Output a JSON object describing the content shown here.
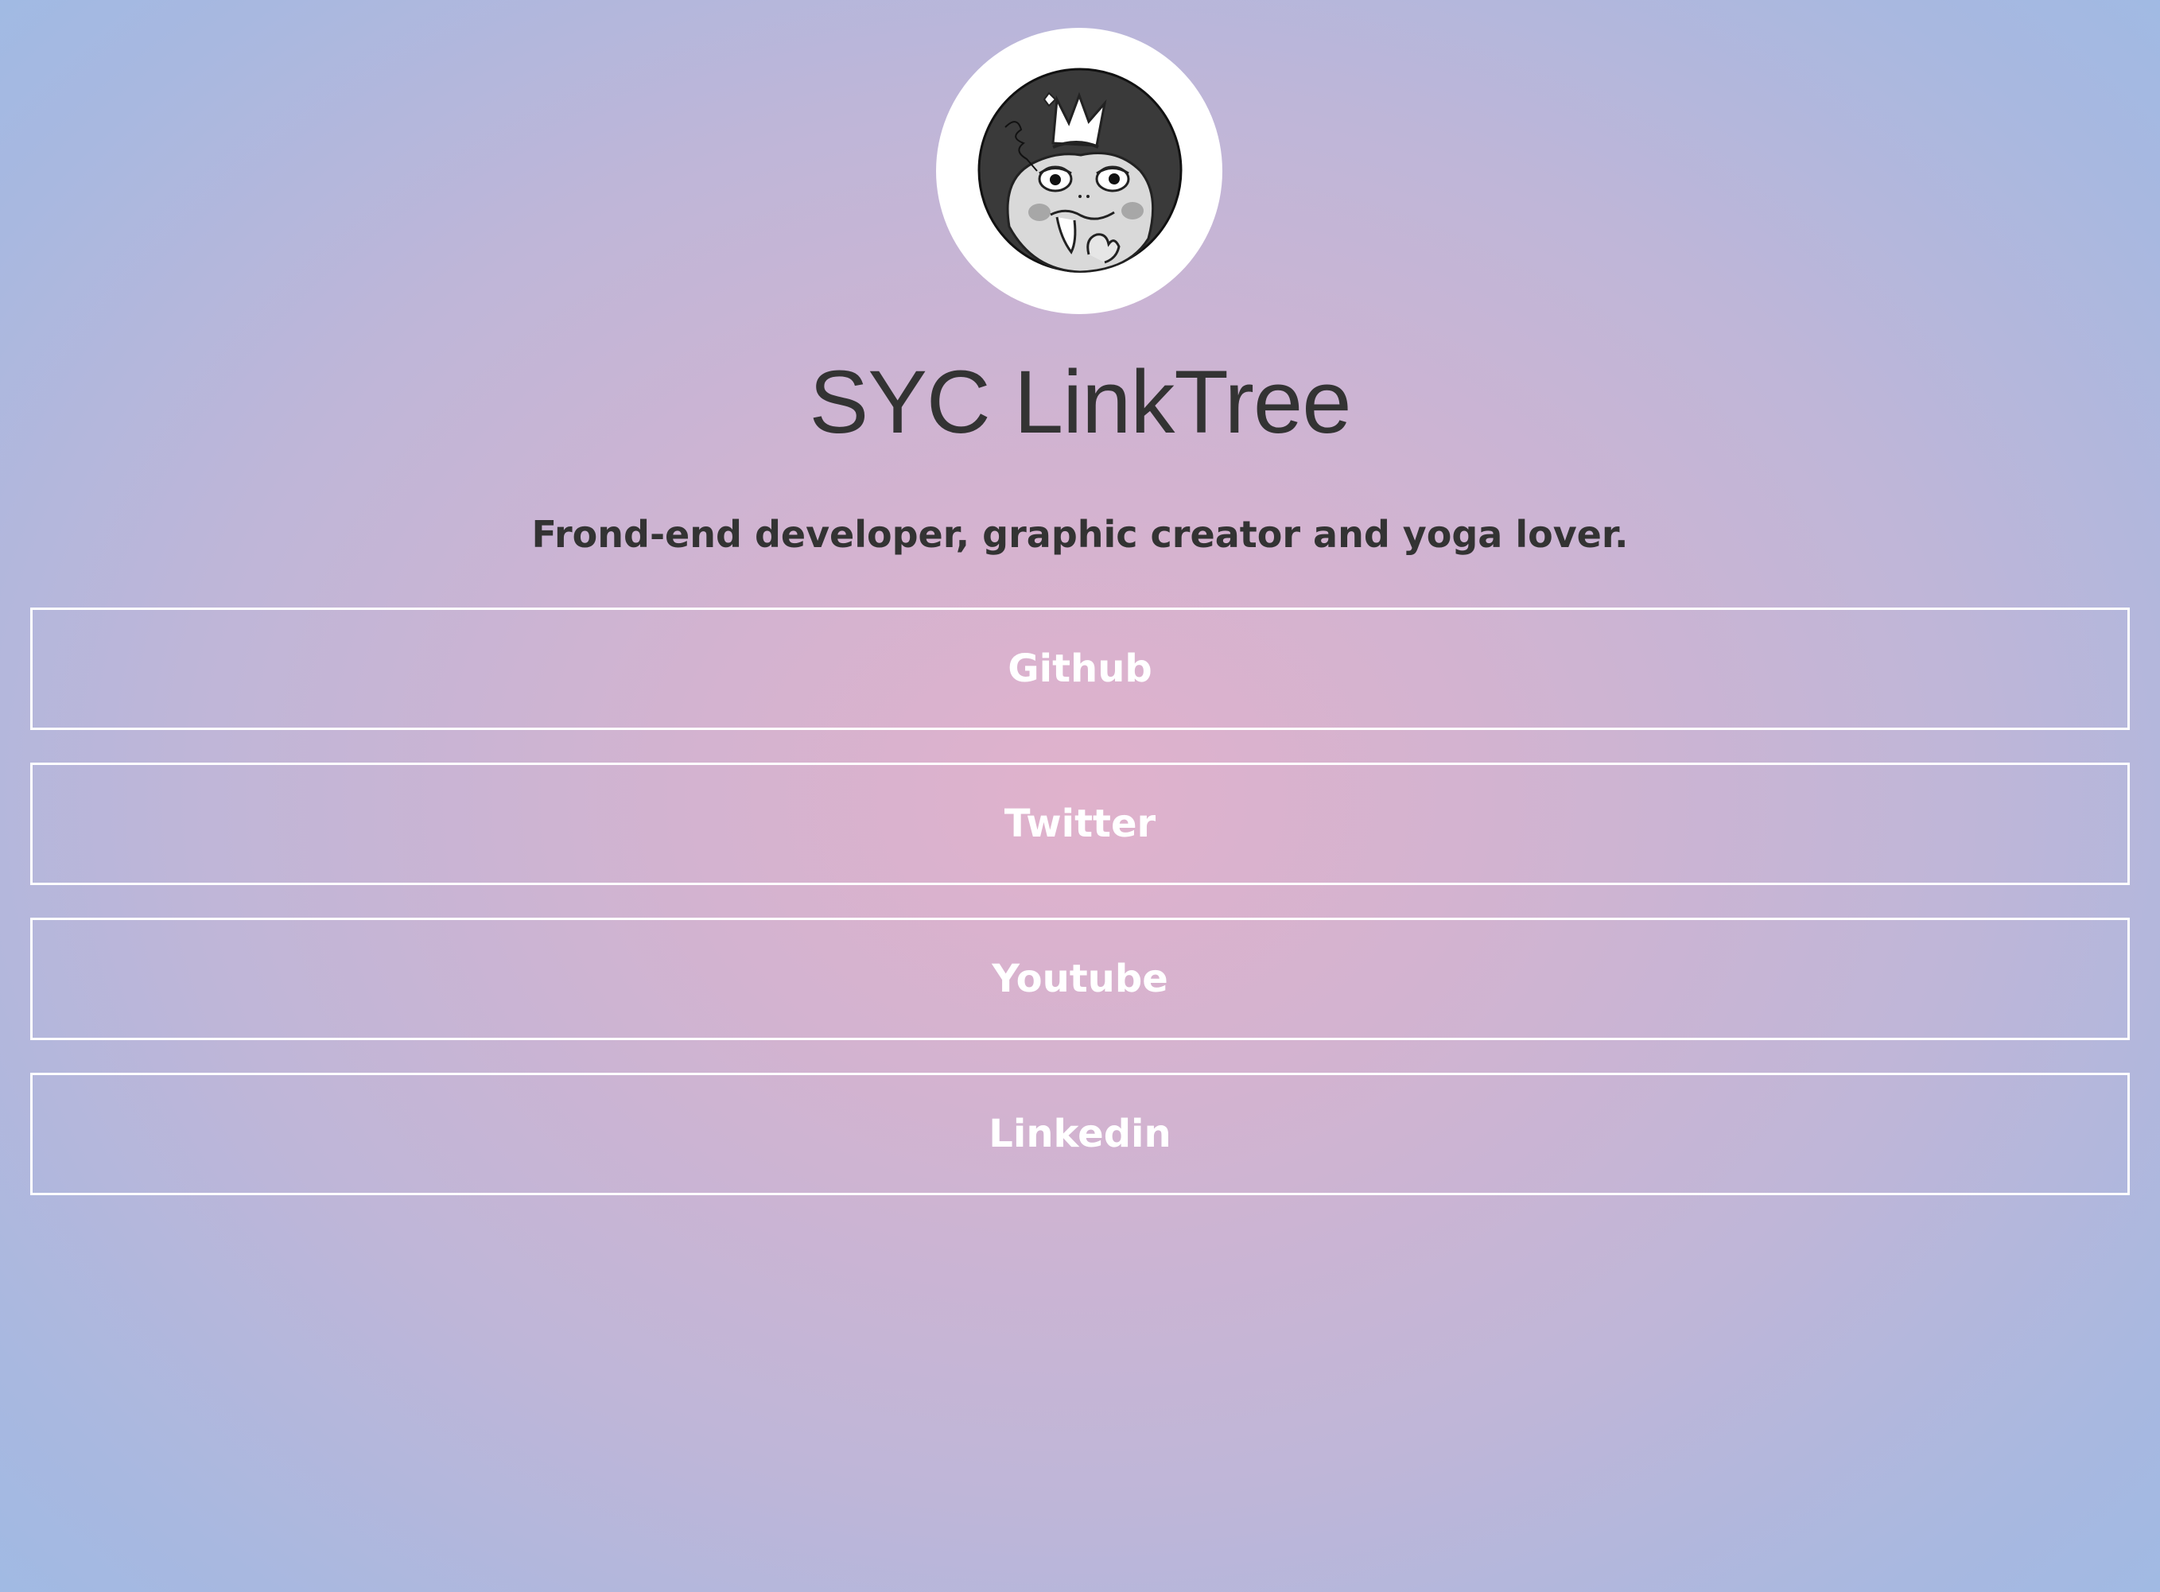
{
  "profile": {
    "title": "SYC LinkTree",
    "tagline": "Frond-end developer, graphic creator and yoga lover."
  },
  "links": [
    {
      "label": "Github"
    },
    {
      "label": "Twitter"
    },
    {
      "label": "Youtube"
    },
    {
      "label": "Linkedin"
    }
  ],
  "colors": {
    "text": "#333333",
    "button_border": "#ffffff",
    "button_text": "#ffffff",
    "background_center": "#e0b2cc",
    "background_edge": "#9bbbe6"
  },
  "icons": {
    "avatar": "frog-with-crown-avatar"
  }
}
